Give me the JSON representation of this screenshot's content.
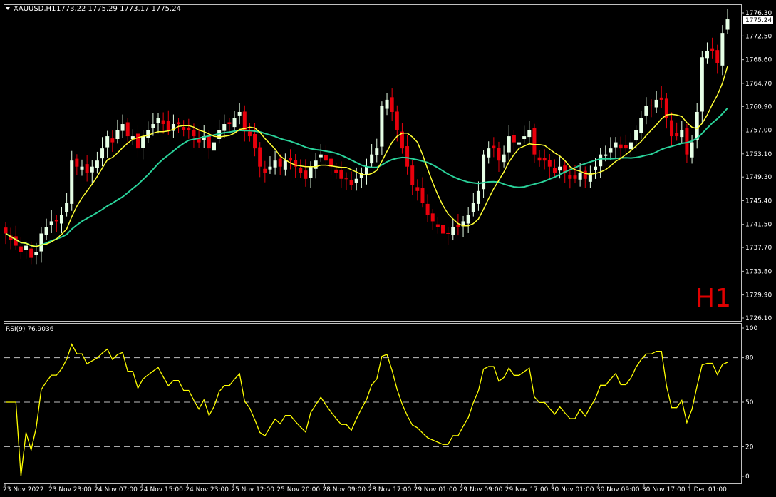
{
  "header": {
    "menu_icon": "triangle-down-icon",
    "symbol": "XAUUSD,H1",
    "ohlc": "1773.22 1775.29 1773.17 1775.24"
  },
  "timeframe_label": "H1",
  "price_marker": "1775.24",
  "colors": {
    "background": "#000000",
    "bull": "#e6ffe6",
    "bear": "#e8000c",
    "ma_fast": "#ffff33",
    "ma_slow": "#2ad29a",
    "rsi_line": "#ffff00",
    "grid": "#c0c0c0"
  },
  "chart_data": [
    {
      "type": "candlestick",
      "symbol": "XAUUSD",
      "timeframe": "H1",
      "ylim": [
        1726.1,
        1776.3
      ],
      "y_ticks": [
        1776.3,
        1772.5,
        1768.6,
        1764.7,
        1760.9,
        1757.0,
        1753.1,
        1749.3,
        1745.4,
        1741.5,
        1737.7,
        1733.8,
        1729.9,
        1726.1
      ],
      "x_ticks": [
        "23 Nov 2022",
        "23 Nov 23:00",
        "24 Nov 07:00",
        "24 Nov 15:00",
        "24 Nov 23:00",
        "25 Nov 12:00",
        "25 Nov 20:00",
        "28 Nov 09:00",
        "28 Nov 17:00",
        "29 Nov 01:00",
        "29 Nov 09:00",
        "29 Nov 17:00",
        "30 Nov 01:00",
        "30 Nov 09:00",
        "30 Nov 17:00",
        "1 Dec 01:00"
      ],
      "close": [
        1740,
        1739,
        1738,
        1737,
        1738,
        1736,
        1737,
        1740,
        1741,
        1742,
        1742,
        1743,
        1745,
        1752,
        1751,
        1751,
        1750,
        1751,
        1752,
        1754,
        1756,
        1755,
        1757,
        1758,
        1756,
        1756,
        1754,
        1756,
        1757,
        1758,
        1759,
        1758,
        1757,
        1758,
        1758,
        1757,
        1757,
        1756,
        1755,
        1756,
        1754,
        1755,
        1757,
        1758,
        1758,
        1759,
        1760,
        1757,
        1756,
        1754,
        1751,
        1750,
        1751,
        1752,
        1751,
        1752,
        1752,
        1751,
        1750,
        1749,
        1751,
        1752,
        1753,
        1752,
        1751,
        1750,
        1749,
        1749,
        1748,
        1749,
        1750,
        1751,
        1753,
        1754,
        1761,
        1762,
        1760,
        1757,
        1754,
        1751,
        1748,
        1747,
        1745,
        1743,
        1742,
        1741,
        1740,
        1740,
        1741,
        1741,
        1742,
        1743,
        1745,
        1747,
        1753,
        1754,
        1754,
        1752,
        1753,
        1756,
        1755,
        1755,
        1756,
        1757,
        1753,
        1752,
        1752,
        1751,
        1750,
        1751,
        1750,
        1749,
        1749,
        1750,
        1749,
        1750,
        1751,
        1753,
        1753,
        1754,
        1755,
        1754,
        1754,
        1755,
        1757,
        1759,
        1761,
        1761,
        1762,
        1762,
        1759,
        1756,
        1756,
        1757,
        1753,
        1755,
        1760,
        1769,
        1770,
        1770,
        1768,
        1773,
        1775.24
      ],
      "rsi": {
        "period": 9,
        "current": 76.9036,
        "ylim": [
          0,
          100
        ],
        "levels": [
          20,
          50,
          80
        ],
        "y_ticks": [
          100,
          80,
          50,
          20,
          0
        ]
      }
    }
  ],
  "rsi_label": "RSI(9) 76.9036"
}
